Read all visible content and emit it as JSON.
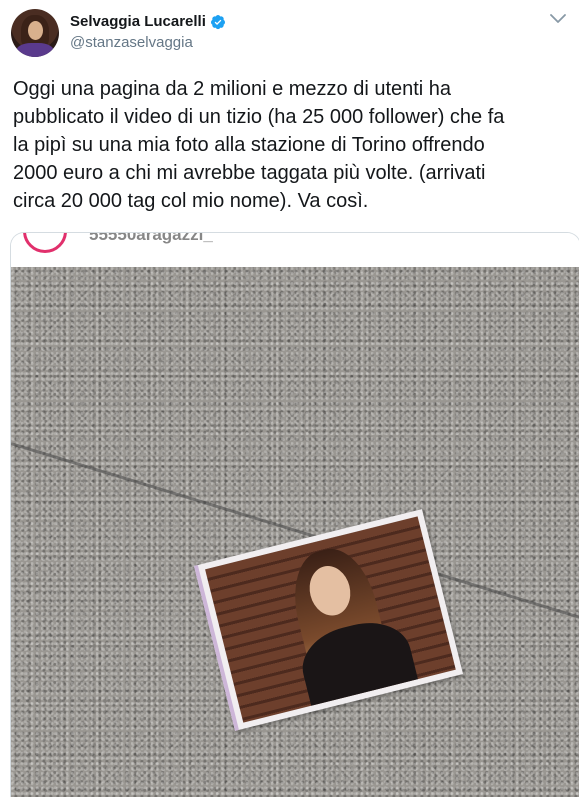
{
  "tweet": {
    "display_name": "Selvaggia Lucarelli",
    "handle": "@stanzaselvaggia",
    "verified": true,
    "text": "Oggi una pagina da 2 milioni e mezzo di utenti ha\npubblicato il video di un tizio (ha 25 000 follower) che fa\nla pipì su una mia foto alla stazione di Torino offrendo\n2000 euro a chi mi avrebbe taggata più volte. (arrivati\ncirca 20 000 tag col mio nome). Va così.",
    "media": {
      "embedded_account_name": "55550aragazzi_"
    }
  },
  "icons": {
    "verified": "verified-badge-icon",
    "menu": "chevron-down-icon"
  },
  "colors": {
    "verified_blue": "#1da1f2",
    "handle_gray": "#657786",
    "text": "#14171a"
  }
}
